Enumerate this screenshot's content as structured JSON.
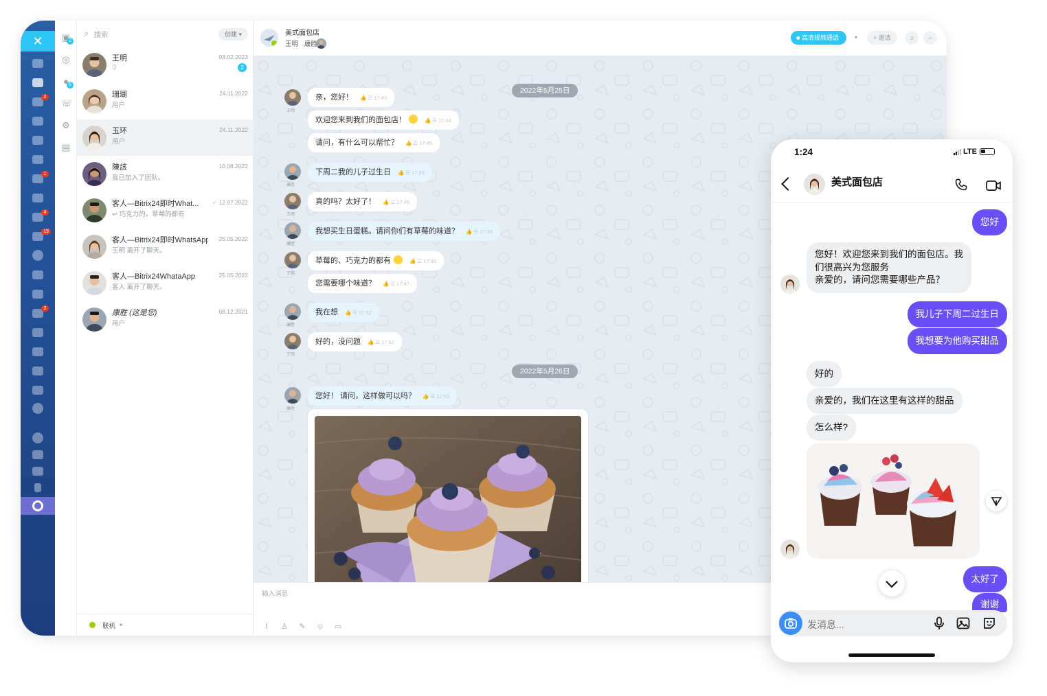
{
  "desktop": {
    "close_label": "✕",
    "sidebar_badges": [
      "2",
      "1",
      "4",
      "19",
      "2"
    ],
    "tool_badges": [
      "2",
      "5"
    ],
    "search": {
      "placeholder": "搜索",
      "create_label": "创建"
    },
    "chats": [
      {
        "name": "王明",
        "preview": ":)",
        "date": "03.02.2023",
        "badge": "2"
      },
      {
        "name": "珊瑚",
        "preview": "用户",
        "date": "24.11.2022",
        "badge": ""
      },
      {
        "name": "玉环",
        "preview": "用户",
        "date": "24.11.2022",
        "badge": ""
      },
      {
        "name": "陳該",
        "preview": "我已加入了团队。",
        "date": "10.08.2022",
        "badge": ""
      },
      {
        "name": "客人—Bitrix24即时What...",
        "preview": "↩ 巧克力的，草莓的都有",
        "date": "12.07.2022",
        "badge": ""
      },
      {
        "name": "客人—Bitrix24即时WhatsApp",
        "preview": "王明 离开了聊天。",
        "date": "25.05.2022",
        "badge": ""
      },
      {
        "name": "客人—Bitrix24WhataApp",
        "preview": "客人 离开了聊天。",
        "date": "25.05.2022",
        "badge": ""
      },
      {
        "name": "康胜 (这是您)",
        "preview": "用户",
        "date": "08.12.2021",
        "badge": ""
      }
    ],
    "status_label": "联机",
    "header": {
      "title": "美式面包店",
      "members": [
        "王明",
        "康胜"
      ],
      "video_label": "高清视频通话",
      "invite_label": "+ 邀请"
    },
    "dates": [
      "2022年5月25日",
      "2022年5月26日"
    ],
    "messages": [
      {
        "author": "王明",
        "text": "亲，您好！",
        "time": "17:43"
      },
      {
        "author": "",
        "text": "欢迎您来到我们的面包店！",
        "time": "17:44",
        "emoji": true
      },
      {
        "author": "",
        "text": "请问，有什么可以帮忙？",
        "time": "17:45"
      },
      {
        "author": "康胜",
        "text": "下周二我的儿子过生日",
        "time": "17:45"
      },
      {
        "author": "王明",
        "text": "真的吗？太好了！",
        "time": "17:45"
      },
      {
        "author": "康胜",
        "text": "我想买生日蛋糕。请问你们有草莓的味道？",
        "time": "17:46"
      },
      {
        "author": "王明",
        "text": "草莓的、巧克力的都有",
        "time": "17:46",
        "emoji": true
      },
      {
        "author": "",
        "text": "您需要哪个味道？",
        "time": "17:47"
      },
      {
        "author": "康胜",
        "text": "我在想",
        "time": "17:52"
      },
      {
        "author": "王明",
        "text": "好的，没问题",
        "time": "17:52"
      },
      {
        "author": "康胜",
        "text": "您好！ 请问，这样做可以吗？",
        "time": "12:53"
      }
    ],
    "composer_placeholder": "输入消息"
  },
  "phone": {
    "time": "1:24",
    "network": "LTE",
    "title": "美式面包店",
    "messages": [
      {
        "dir": "out",
        "text": "您好"
      },
      {
        "dir": "in",
        "lines": [
          "您好！欢迎您来到我们的面包店。我",
          "们很高兴为您服务",
          "亲爱的，请问您需要哪些产品？"
        ]
      },
      {
        "dir": "out",
        "text": "我儿子下周二过生日"
      },
      {
        "dir": "out",
        "text": "我想要为他购买甜品"
      },
      {
        "dir": "in",
        "text": "好的"
      },
      {
        "dir": "in",
        "text": "亲爱的，我们在这里有这样的甜品"
      },
      {
        "dir": "in",
        "text": "怎么样?"
      },
      {
        "dir": "out",
        "text": "太好了"
      },
      {
        "dir": "out",
        "text": "谢谢"
      }
    ],
    "input_placeholder": "发消息..."
  },
  "colors": {
    "accent": "#2fc6f6",
    "sidebar": "#2a5fa6",
    "phone_bubble": "#6a4ff7",
    "online": "#9dcf00"
  }
}
